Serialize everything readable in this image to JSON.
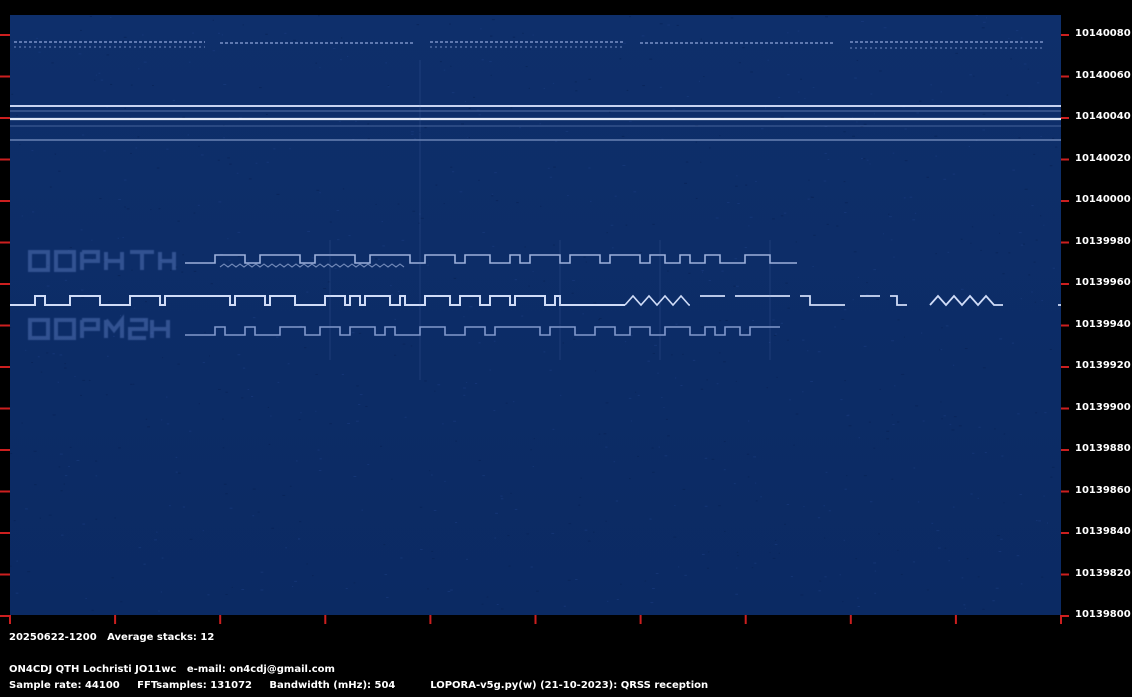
{
  "header": {
    "date_label": "20250622-1200",
    "stacks_label": "Average stacks: 12"
  },
  "station": {
    "line": "ON4CDJ QTH Lochristi JO11wc   e-mail: on4cdj@gmail.com"
  },
  "params": {
    "sample_rate": "Sample rate: 44100",
    "fft": "FFTsamples: 131072",
    "bandwidth": "Bandwidth (mHz): 504",
    "software": "LOPORA-v5g.py(w) (21-10-2023): QRSS reception"
  },
  "axis": {
    "y_ticks": [
      "10140080",
      "10140060",
      "10140040",
      "10140020",
      "10140000",
      "10139980",
      "10139960",
      "10139940",
      "10139920",
      "10139900",
      "10139880",
      "10139860",
      "10139840",
      "10139820",
      "10139800"
    ]
  },
  "colors": {
    "background": "#0b2a63",
    "frame": "#000000",
    "tick": "#cc1f1f",
    "signal": "#dbe6ff"
  }
}
